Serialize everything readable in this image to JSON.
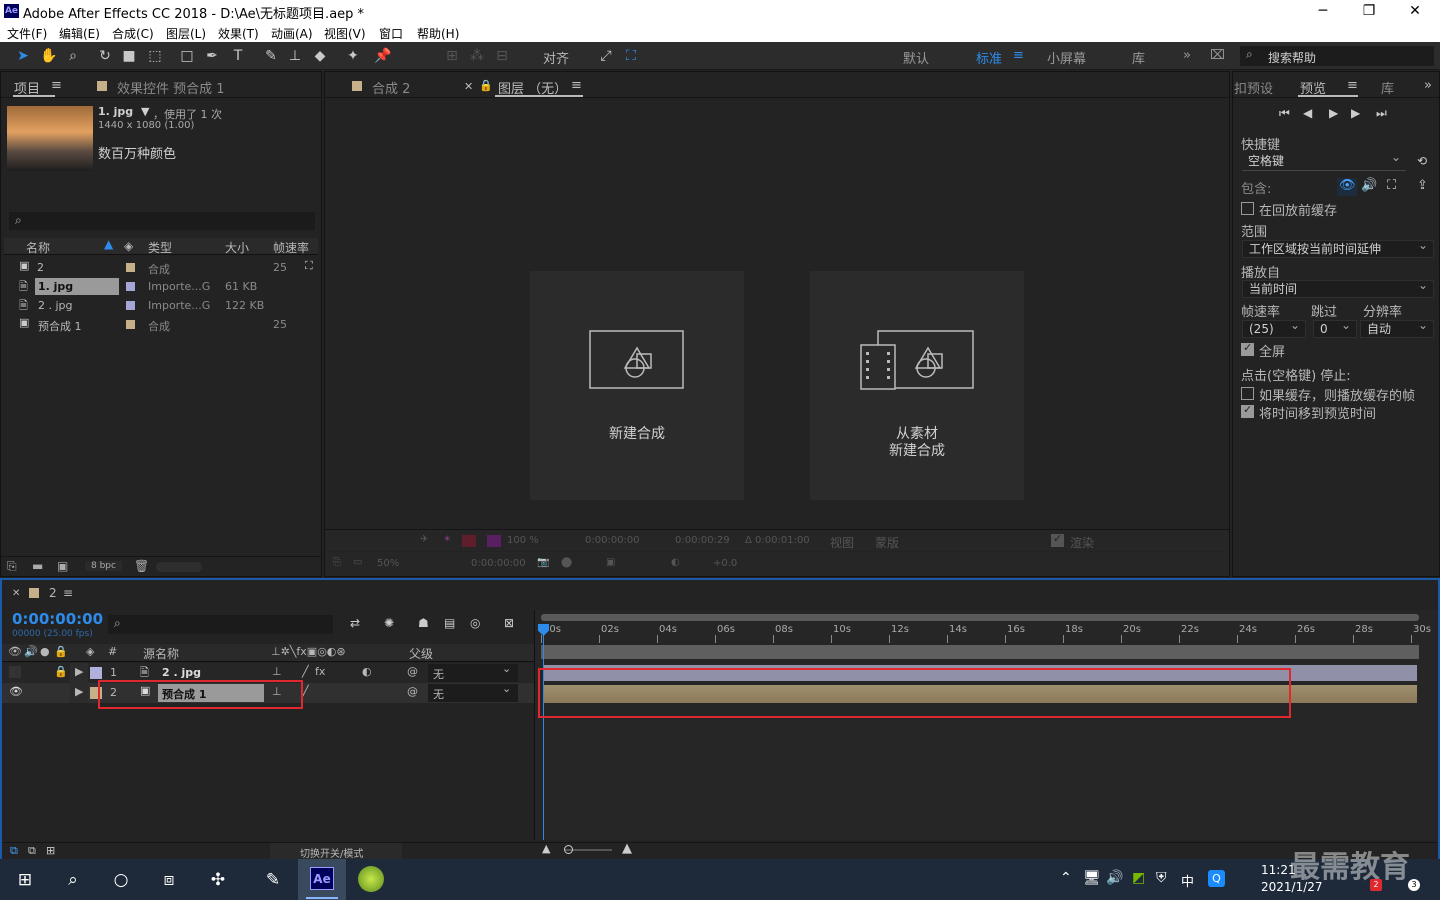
{
  "titlebar": {
    "title": "Adobe After Effects CC 2018 - D:\\Ae\\无标题项目.aep *",
    "logo": "Ae",
    "min": "─",
    "max": "❐",
    "close": "✕"
  },
  "menu": [
    "文件(F)",
    "编辑(E)",
    "合成(C)",
    "图层(L)",
    "效果(T)",
    "动画(A)",
    "视图(V)",
    "窗口",
    "帮助(H)"
  ],
  "toolbar": {
    "align_label": "对齐",
    "workspaces": [
      "默认",
      "标准",
      "小屏幕",
      "库"
    ],
    "active_workspace": "标准",
    "search_placeholder": "搜索帮助"
  },
  "project": {
    "tab": "项目",
    "effects_tab": "效果控件 预合成 1",
    "file_name": "1. jpg",
    "usage": "，使用了 1 次",
    "dims": "1440 x 1080 (1.00)",
    "color": "数百万种颜色",
    "search_icon": "⌕",
    "headers": {
      "name": "名称",
      "type": "类型",
      "size": "大小",
      "fps": "帧速率"
    },
    "items": [
      {
        "name": "2",
        "type": "合成",
        "size": "",
        "fps": "25"
      },
      {
        "name": "1. jpg",
        "type": "Importe...G",
        "size": "61 KB",
        "fps": ""
      },
      {
        "name": "2 . jpg",
        "type": "Importe...G",
        "size": "122 KB",
        "fps": ""
      },
      {
        "name": "预合成 1",
        "type": "合成",
        "size": "",
        "fps": "25"
      }
    ],
    "bpc": "8 bpc"
  },
  "viewer": {
    "tab_comp": "合成 2",
    "tab_layer": "图层 （无）",
    "new_comp": "新建合成",
    "from_footage_line1": "从素材",
    "from_footage_line2": "新建合成",
    "footer1": {
      "zoom": "100 %",
      "t1": "0:00:00:00",
      "t2": "0:00:00:29",
      "t3": "Δ 0:00:01:00",
      "view": "视图",
      "mask": "蒙版",
      "render": "渲染"
    },
    "footer2": {
      "zoom": "50%",
      "time": "0:00:00:00",
      "offset": "+0.0"
    }
  },
  "preview": {
    "tab_presets": "扣预设",
    "tab": "预览",
    "tab_lib": "库",
    "shortcut_label": "快捷键",
    "shortcut_value": "空格键",
    "include": "包含:",
    "cache_label": "在回放前缓存",
    "range_label": "范围",
    "range_value": "工作区域按当前时间延伸",
    "play_from_label": "播放自",
    "play_from_value": "当前时间",
    "fps_label": "帧速率",
    "skip_label": "跳过",
    "res_label": "分辨率",
    "fps_value": "(25)",
    "skip_value": "0",
    "res_value": "自动",
    "fullscreen": "全屏",
    "stop_label": "点击(空格键) 停止:",
    "cached_label": "如果缓存，则播放缓存的帧",
    "move_time_label": "将时间移到预览时间"
  },
  "timeline": {
    "tab": "2",
    "timecode": "0:00:00:00",
    "fps_sub": "00000 (25.00 fps)",
    "col_source": "源名称",
    "col_parent": "父级",
    "col_num": "#",
    "layers": [
      {
        "num": "1",
        "name": "2 . jpg",
        "parent": "无"
      },
      {
        "num": "2",
        "name": "预合成 1",
        "parent": "无"
      }
    ],
    "ruler": [
      "00s",
      "02s",
      "04s",
      "06s",
      "08s",
      "10s",
      "12s",
      "14s",
      "16s",
      "18s",
      "20s",
      "22s",
      "24s",
      "26s",
      "28s",
      "30s"
    ],
    "toggle_label": "切换开关/模式"
  },
  "taskbar": {
    "time": "11:21",
    "date": "2021/1/27",
    "ime": "中",
    "notif": "3",
    "badge": "2",
    "watermark": "最需教育"
  }
}
